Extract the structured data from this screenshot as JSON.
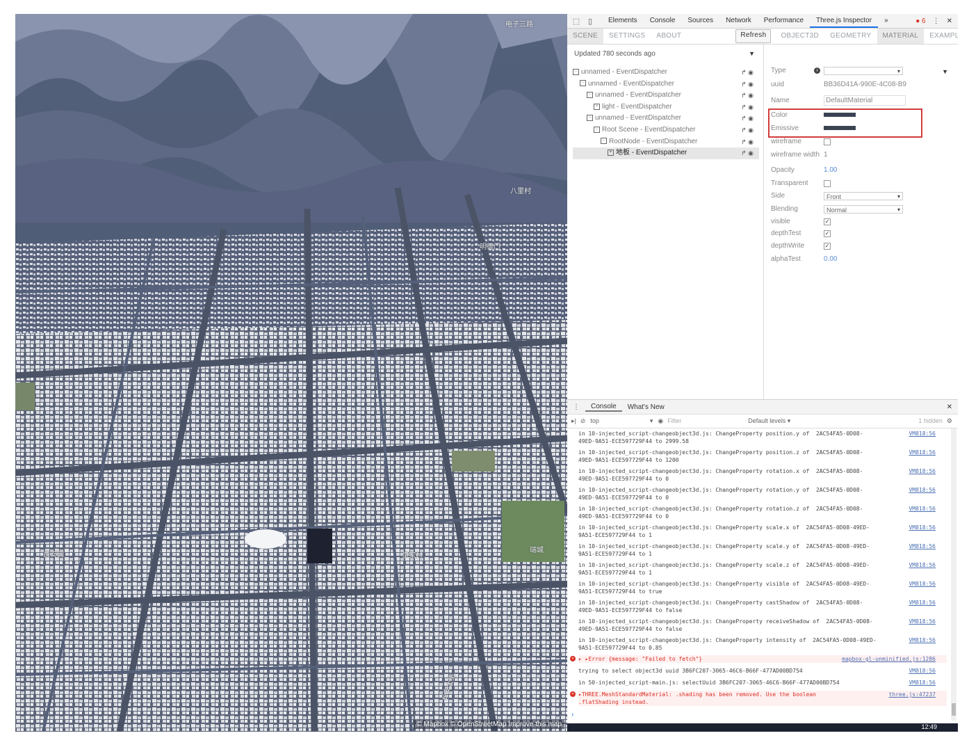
{
  "map": {
    "labels": [
      "明德门",
      "八里村",
      "西安园",
      "瑞城",
      "长安大街",
      "伊家村",
      "电子三路"
    ],
    "attribution": "© Mapbox © OpenStreetMap Improve this map"
  },
  "devtools": {
    "tabs": [
      "Elements",
      "Console",
      "Sources",
      "Network",
      "Performance",
      "Three.js Inspector"
    ],
    "more": "»",
    "error_count": "6",
    "close": "✕",
    "menu": "⋮"
  },
  "inspector": {
    "left_tabs": [
      "SCENE",
      "SETTINGS",
      "ABOUT"
    ],
    "refresh_label": "Refresh",
    "right_tabs": [
      "OBJECT3D",
      "GEOMETRY",
      "MATERIAL",
      "EXAMPLES"
    ],
    "updated_text": "Updated 780 seconds ago",
    "tree": [
      {
        "label": "unnamed - EventDispatcher",
        "box": "−"
      },
      {
        "label": "unnamed - EventDispatcher",
        "box": "−"
      },
      {
        "label": "unnamed - EventDispatcher",
        "box": "−"
      },
      {
        "label": "light - EventDispatcher",
        "box": "+"
      },
      {
        "label": "unnamed - EventDispatcher",
        "box": "−"
      },
      {
        "label": "Root Scene - EventDispatcher",
        "box": "−"
      },
      {
        "label": "RootNode - EventDispatcher",
        "box": "−"
      },
      {
        "label": "地板 - EventDispatcher",
        "box": "+"
      }
    ],
    "node_actions": "↱ ◉"
  },
  "material": {
    "type_label": "Type",
    "uuid_label": "uuid",
    "uuid_value": "BB36D41A-990E-4C08-B9",
    "name_label": "Name",
    "name_value": "DefaultMaterial",
    "color_label": "Color",
    "emissive_label": "Emissive",
    "wireframe_label": "wireframe",
    "wireframe_width_label": "wireframe width",
    "wireframe_width_value": "1",
    "opacity_label": "Opacity",
    "opacity_value": "1.00",
    "transparent_label": "Transparent",
    "side_label": "Side",
    "side_value": "Front",
    "blending_label": "Blending",
    "blending_value": "Normal",
    "visible_label": "visible",
    "depthtest_label": "depthTest",
    "depthwrite_label": "depthWrite",
    "alphatest_label": "alphaTest",
    "alphatest_value": "0.00",
    "swatch_color": "#3b4252",
    "highlight_color": "#d33a3a"
  },
  "console": {
    "drawer_tabs": [
      "Console",
      "What's New"
    ],
    "context": "top",
    "filter_placeholder": "Filter",
    "levels": "Default levels ▾",
    "hidden": "1 hidden",
    "lines": [
      {
        "text": "in 10-injected_script-changeobject3d.js: ChangeProperty position.y of  2AC54FA5-0D08-\n49ED-9A51-ECE597729F44 to 2999.58",
        "src": "VM818:56",
        "err": false
      },
      {
        "text": "in 10-injected_script-changeobject3d.js: ChangeProperty position.z of  2AC54FA5-0D08-\n49ED-9A51-ECE597729F44 to 1200",
        "src": "VM818:56",
        "err": false
      },
      {
        "text": "in 10-injected_script-changeobject3d.js: ChangeProperty rotation.x of  2AC54FA5-0D08-\n49ED-9A51-ECE597729F44 to 0",
        "src": "VM818:56",
        "err": false
      },
      {
        "text": "in 10-injected_script-changeobject3d.js: ChangeProperty rotation.y of  2AC54FA5-0D08-\n49ED-9A51-ECE597729F44 to 0",
        "src": "VM818:56",
        "err": false
      },
      {
        "text": "in 10-injected_script-changeobject3d.js: ChangeProperty rotation.z of  2AC54FA5-0D08-\n49ED-9A51-ECE597729F44 to 0",
        "src": "VM818:56",
        "err": false
      },
      {
        "text": "in 10-injected_script-changeobject3d.js: ChangeProperty scale.x of  2AC54FA5-0D08-49ED-\n9A51-ECE597729F44 to 1",
        "src": "VM818:56",
        "err": false
      },
      {
        "text": "in 10-injected_script-changeobject3d.js: ChangeProperty scale.y of  2AC54FA5-0D08-49ED-\n9A51-ECE597729F44 to 1",
        "src": "VM818:56",
        "err": false
      },
      {
        "text": "in 10-injected_script-changeobject3d.js: ChangeProperty scale.z of  2AC54FA5-0D08-49ED-\n9A51-ECE597729F44 to 1",
        "src": "VM818:56",
        "err": false
      },
      {
        "text": "in 10-injected_script-changeobject3d.js: ChangeProperty visible of  2AC54FA5-0D08-49ED-\n9A51-ECE597729F44 to true",
        "src": "VM818:56",
        "err": false
      },
      {
        "text": "in 10-injected_script-changeobject3d.js: ChangeProperty castShadow of  2AC54FA5-0D08-\n49ED-9A51-ECE597729F44 to false",
        "src": "VM818:56",
        "err": false
      },
      {
        "text": "in 10-injected_script-changeobject3d.js: ChangeProperty receiveShadow of  2AC54FA5-0D08-\n49ED-9A51-ECE597729F44 to false",
        "src": "VM818:56",
        "err": false
      },
      {
        "text": "in 10-injected_script-changeobject3d.js: ChangeProperty intensity of  2AC54FA5-0D08-49ED-\n9A51-ECE597729F44 to 0.85",
        "src": "VM818:56",
        "err": false
      },
      {
        "text": "▸ ▸Error {message: \"Failed to fetch\"}",
        "src": "mapbox-gl-unminified.js:1286",
        "err": true
      },
      {
        "text": "trying to select object3d uuid 3B6FC207-3065-46C6-B66F-477AD00BD754",
        "src": "VM818:56",
        "err": false
      },
      {
        "text": "in 50-injected_script-main.js: selectUuid 3B6FC207-3065-46C6-B66F-477AD00BD754",
        "src": "VM818:56",
        "err": false
      },
      {
        "text": "▸THREE.MeshStandardMaterial: .shading has been removed. Use the boolean\n.flatShading instead.",
        "src": "three.js:47237",
        "err": true
      }
    ],
    "prompt": "›"
  },
  "taskbar": {
    "time": "12:49"
  }
}
